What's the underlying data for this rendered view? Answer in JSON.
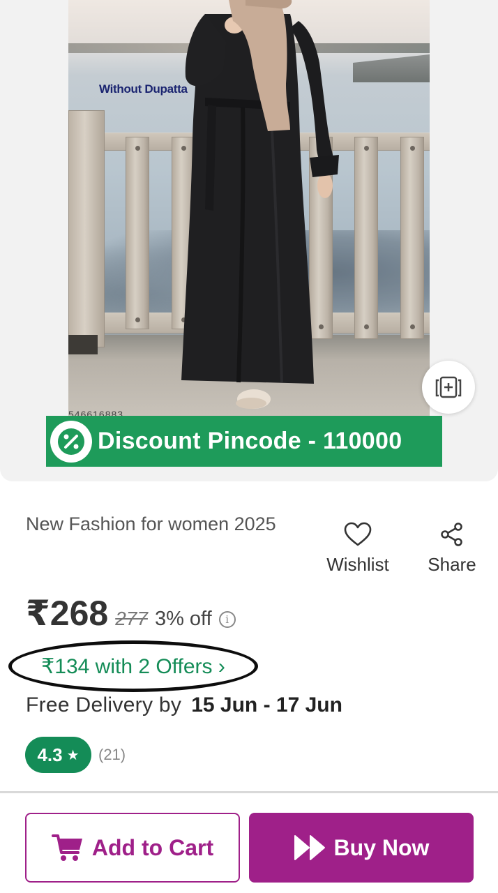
{
  "product_image": {
    "overlay_text": "Without Dupatta",
    "partial_code": "546616883"
  },
  "discount_banner": {
    "icon": "percent-badge-icon",
    "text": "Discount Pincode - 110000"
  },
  "similar_button": {
    "icon": "similar-products-icon"
  },
  "product": {
    "title": "New Fashion for women 2025"
  },
  "actions": {
    "wishlist_label": "Wishlist",
    "wishlist_icon": "heart-icon",
    "share_label": "Share",
    "share_icon": "share-icon"
  },
  "pricing": {
    "price": "₹268",
    "mrp": "277",
    "discount": "3% off",
    "info_icon": "info-icon"
  },
  "offers": {
    "label": "₹134 with 2 Offers ›"
  },
  "delivery": {
    "label": "Free Delivery by",
    "date": "15 Jun - 17 Jun"
  },
  "rating": {
    "value": "4.3",
    "star": "★",
    "count": "(21)"
  },
  "buttons": {
    "add_to_cart": "Add to Cart",
    "add_to_cart_icon": "cart-icon",
    "buy_now": "Buy Now",
    "buy_now_icon": "fast-forward-icon"
  },
  "colors": {
    "brand_purple": "#9f2089",
    "offer_green": "#148c57",
    "banner_green": "#1e9b5a"
  }
}
